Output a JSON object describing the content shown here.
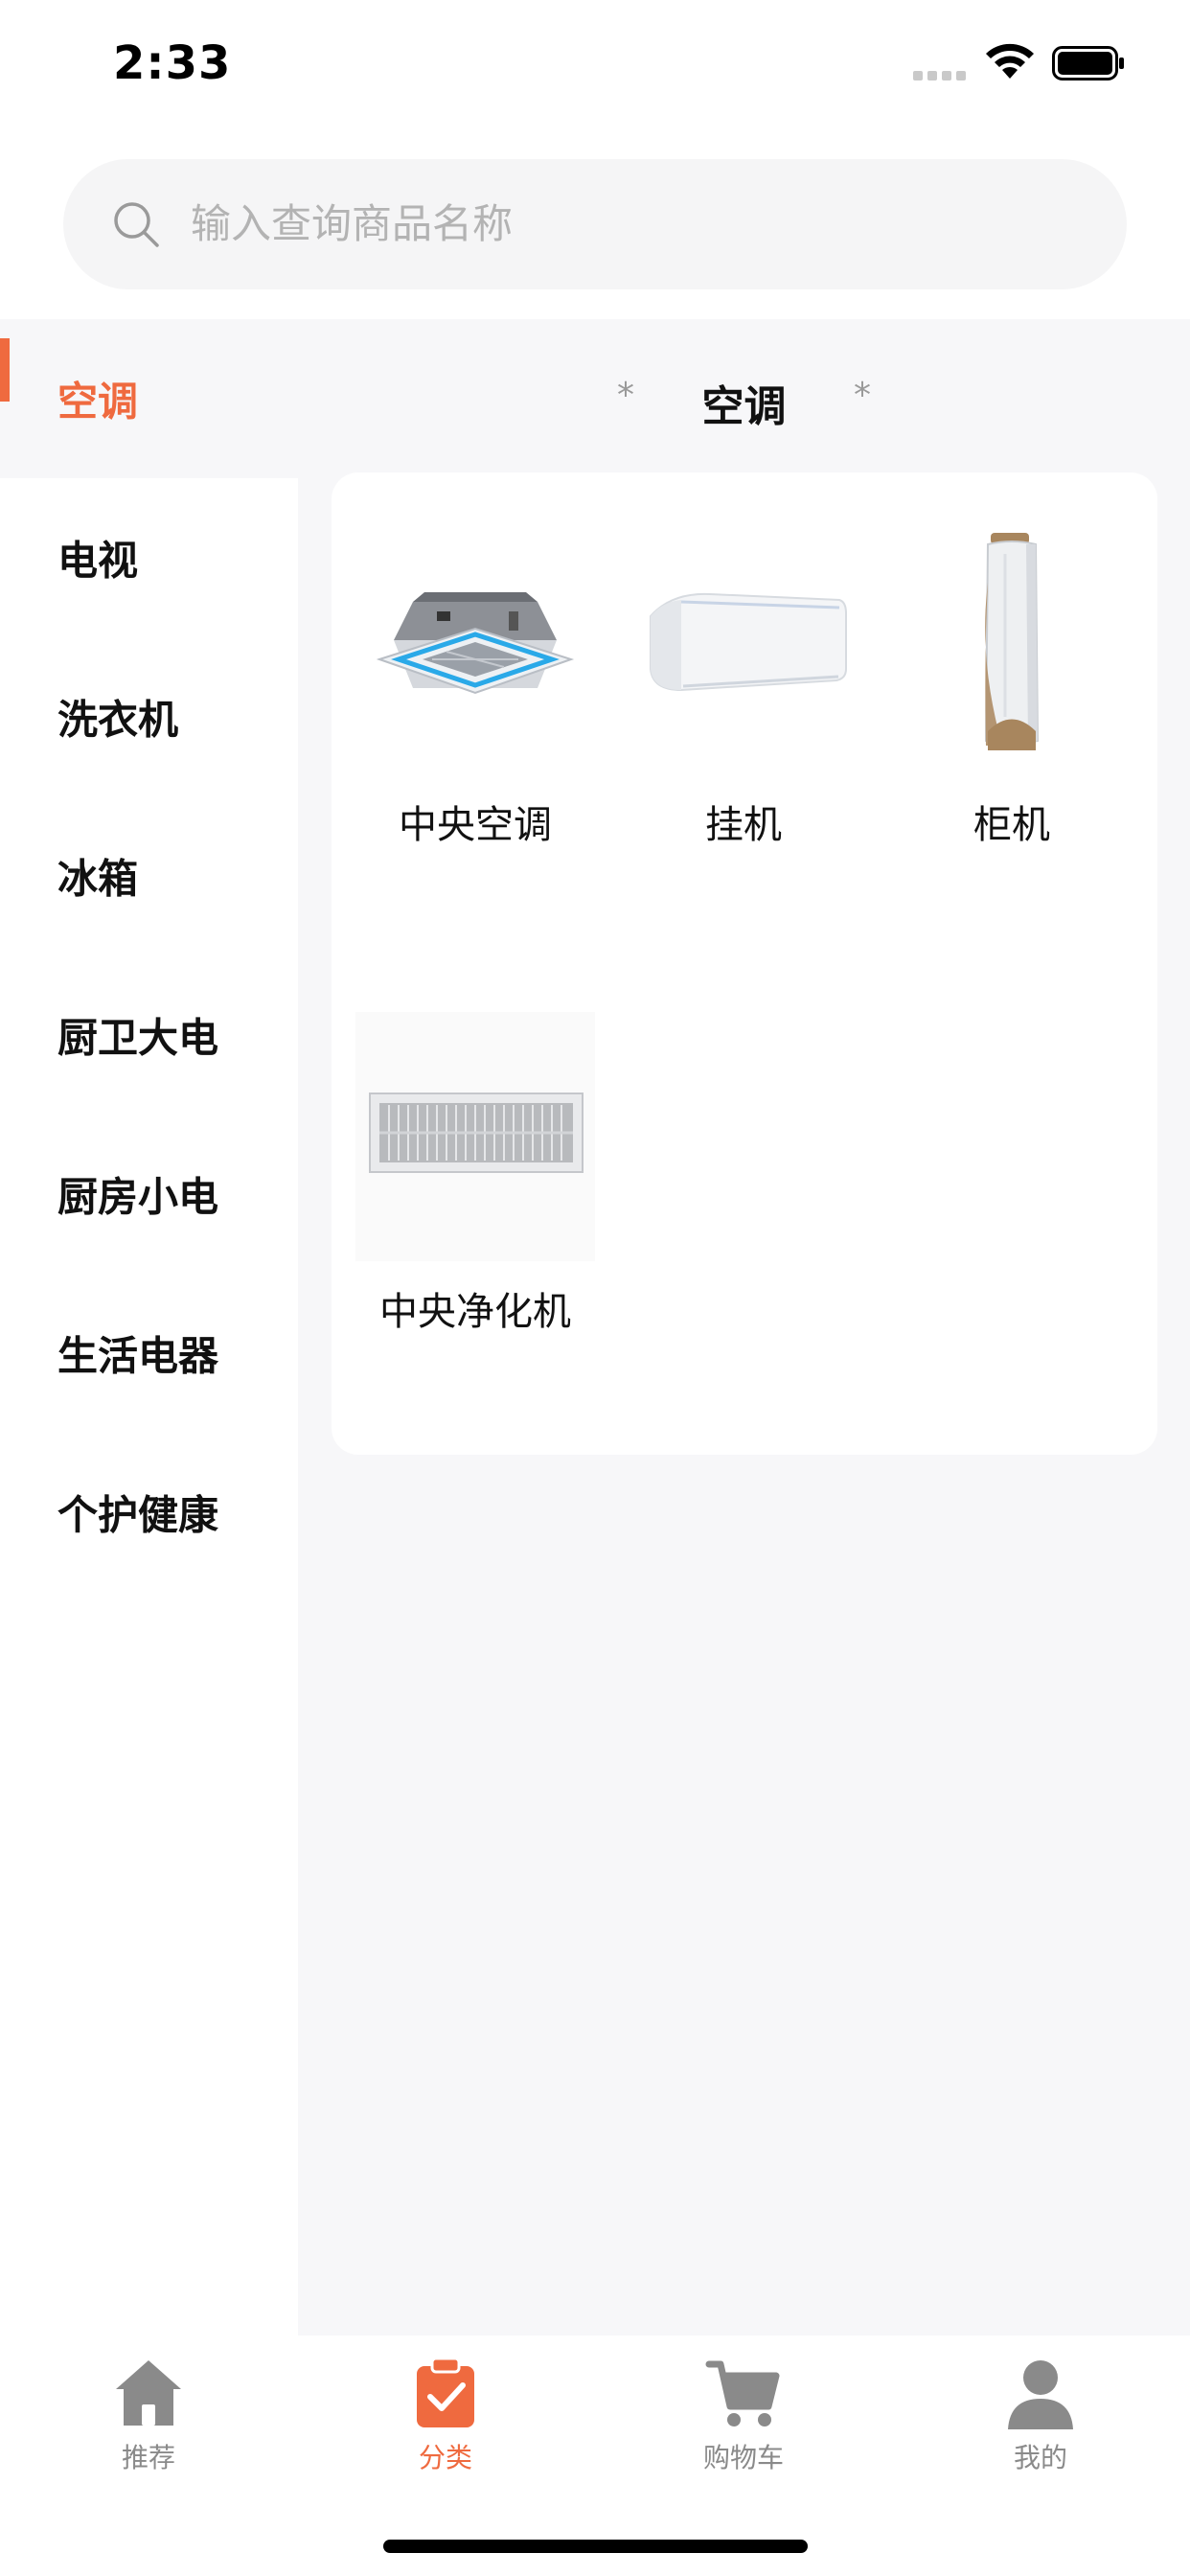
{
  "status_bar": {
    "time": "2:33"
  },
  "search": {
    "placeholder": "输入查询商品名称"
  },
  "sidebar": {
    "items": [
      {
        "label": "空调",
        "active": true
      },
      {
        "label": "电视"
      },
      {
        "label": "洗衣机"
      },
      {
        "label": "冰箱"
      },
      {
        "label": "厨卫大电"
      },
      {
        "label": "厨房小电"
      },
      {
        "label": "生活电器"
      },
      {
        "label": "个护健康"
      }
    ]
  },
  "content": {
    "title": "空调",
    "star_left": "*",
    "star_right": "*",
    "products": [
      {
        "name": "中央空调",
        "icon": "cassette-ac-image"
      },
      {
        "name": "挂机",
        "icon": "wall-ac-image"
      },
      {
        "name": "柜机",
        "icon": "tower-ac-image"
      },
      {
        "name": "中央净化机",
        "icon": "purifier-unit-image"
      }
    ]
  },
  "tabbar": {
    "tabs": [
      {
        "label": "推荐",
        "icon": "home-icon"
      },
      {
        "label": "分类",
        "icon": "clipboard-check-icon",
        "active": true
      },
      {
        "label": "购物车",
        "icon": "cart-icon"
      },
      {
        "label": "我的",
        "icon": "user-icon"
      }
    ]
  },
  "colors": {
    "accent": "#ef6a3f",
    "background": "#f7f7f9",
    "inactive": "#8a8a8a"
  }
}
